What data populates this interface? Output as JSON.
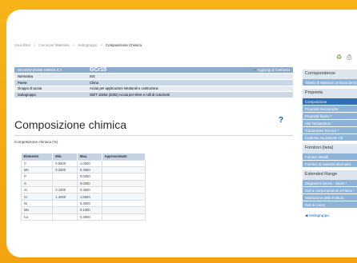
{
  "breadcrumb": {
    "items": [
      "Vous Êtes",
      "Cerca per Materiale",
      "Sottogruppo"
    ],
    "current": "Composizione Chimica"
  },
  "toolbar": {
    "icon_a": "recycle-icon",
    "icon_b": "print-icon"
  },
  "properties": {
    "head_label": "DESIGNAZIONE SIMBOLICA",
    "head_value": "GCr15",
    "add_link": "Aggiungi al Confronto",
    "rows": [
      {
        "key": "Normativa",
        "value": "ISS"
      },
      {
        "key": "Paese",
        "value": "China"
      },
      {
        "key": "Gruppo di acciai",
        "value": "Acciai per applicazioni strutturali e costruzione"
      },
      {
        "key": "Sottogruppo",
        "value": "GB/T 18254 (2002) Acciai per sfere e rulli di cuscinetti"
      }
    ]
  },
  "page_title": "Composizione chimica",
  "help_glyph": "?",
  "section_title": "Composizione chimica (%)",
  "chem_table": {
    "columns": [
      "Elemento",
      "Min.",
      "Max.",
      "Approssimato"
    ],
    "rows": [
      [
        "C",
        "0.9500",
        "1.0500",
        ""
      ],
      [
        "Mn",
        "0.2500",
        "0.4500",
        ""
      ],
      [
        "P",
        "",
        "0.0250",
        ""
      ],
      [
        "S",
        "",
        "0.0250",
        ""
      ],
      [
        "Si",
        "0.1500",
        "0.3500",
        ""
      ],
      [
        "Cr",
        "1.4000",
        "1.6500",
        ""
      ],
      [
        "Ni",
        "",
        "0.3000",
        ""
      ],
      [
        "Mo",
        "",
        "0.1000",
        ""
      ],
      [
        "Cu",
        "",
        "0.2500",
        ""
      ]
    ]
  },
  "sidebar": {
    "sections": [
      {
        "title": "Corrispondenze",
        "items": [
          {
            "label": "Tabella di Materiali corrispondenti",
            "active": false
          }
        ]
      },
      {
        "title": "Proprietà",
        "items": [
          {
            "label": "Composizione",
            "active": true
          },
          {
            "label": "Proprietà meccaniche",
            "active": false
          },
          {
            "label": "Proprietà fisiche *",
            "active": false
          },
          {
            "label": "Alte Temperature",
            "active": false
          },
          {
            "label": "Trattamento Termico *",
            "active": false
          },
          {
            "label": "Carbonio equivalente CE",
            "active": false
          }
        ]
      },
      {
        "title": "Fornitori (beta)",
        "items": [
          {
            "label": "Fornitori Metalli",
            "active": false
          },
          {
            "label": "Fornitori di materiali alternativi",
            "active": false
          }
        ]
      },
      {
        "title": "Extended Range",
        "items": [
          {
            "label": "Diagrammi Stress - Strain *",
            "active": false
          },
          {
            "label": "Dati a comportamento a Fatica *",
            "active": false
          },
          {
            "label": "Valutazione della Frattura",
            "active": false
          },
          {
            "label": "Dati di Creep",
            "active": false
          }
        ]
      }
    ],
    "back_link": "Sottogruppo"
  }
}
